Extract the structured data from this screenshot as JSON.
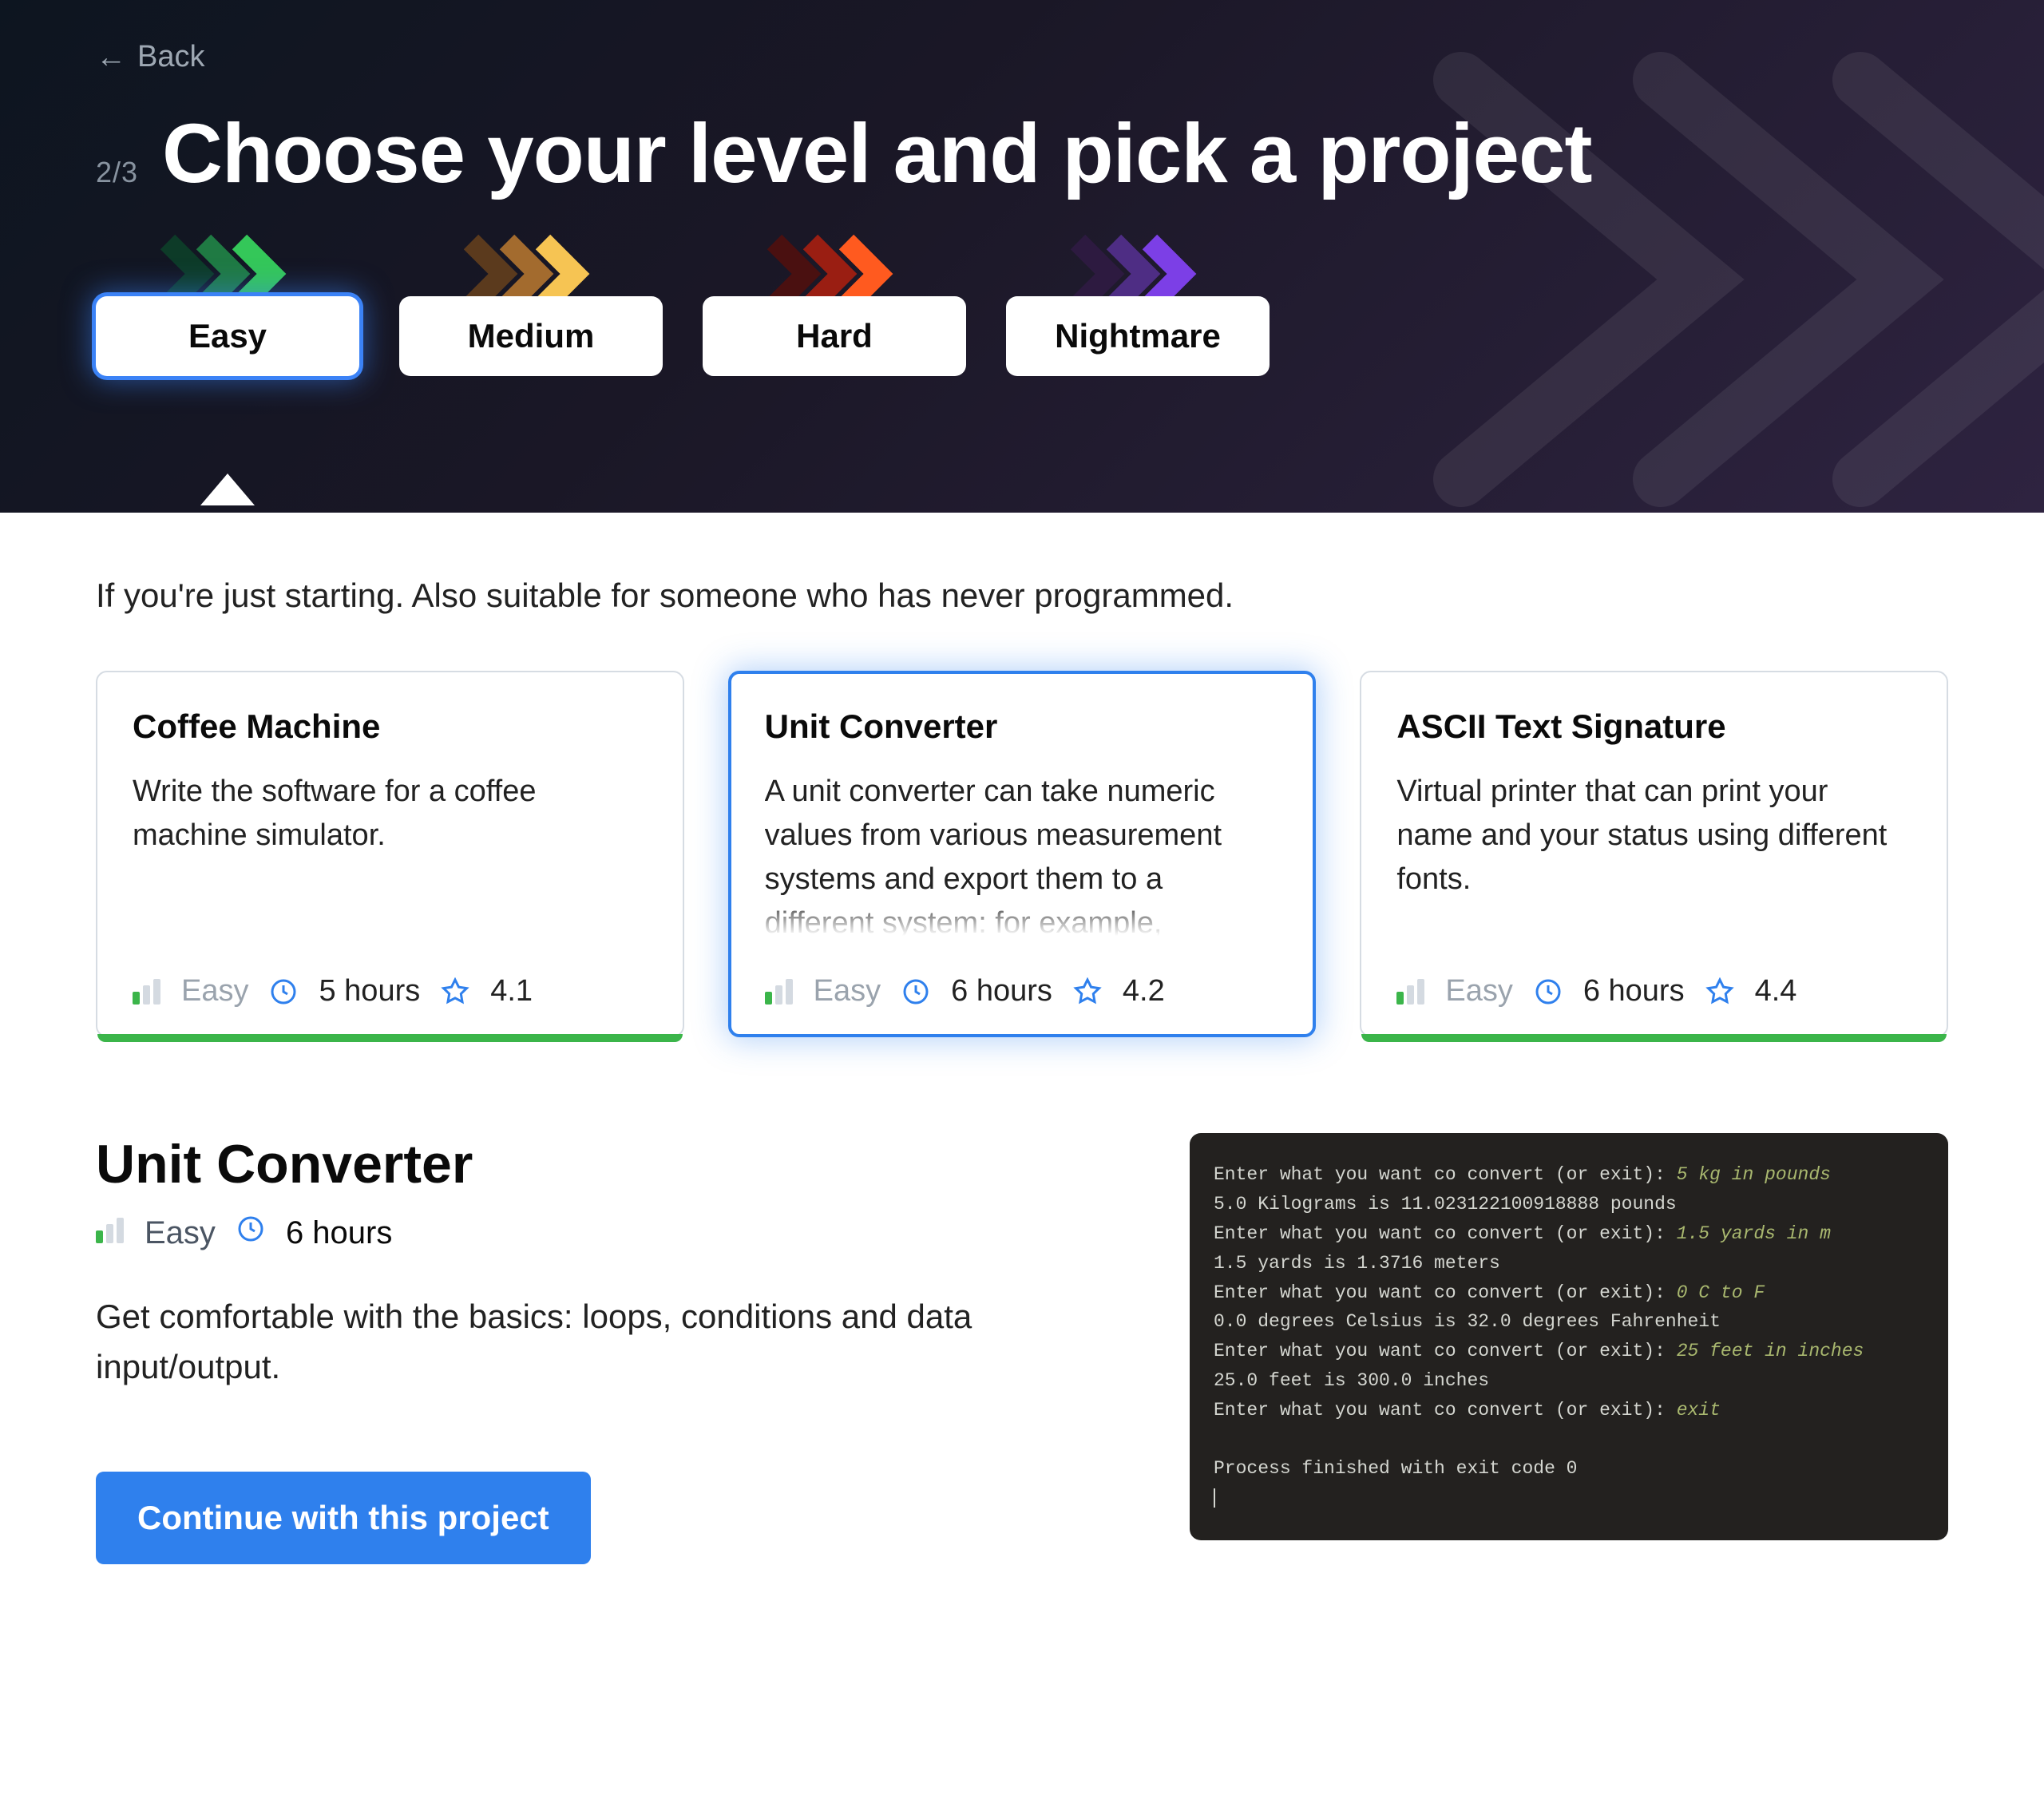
{
  "nav": {
    "back_label": "Back"
  },
  "step": {
    "current": 2,
    "total": 3,
    "display": "2/3"
  },
  "title": "Choose your level and pick a project",
  "levels": {
    "items": [
      {
        "label": "Easy",
        "chevron_colors": [
          "#0d3b28",
          "#1f7a43",
          "#34c759"
        ]
      },
      {
        "label": "Medium",
        "chevron_colors": [
          "#5b3a1d",
          "#a36b2e",
          "#f6c453"
        ]
      },
      {
        "label": "Hard",
        "chevron_colors": [
          "#4a1010",
          "#9a1e12",
          "#ff5a1f"
        ]
      },
      {
        "label": "Nightmare",
        "chevron_colors": [
          "#2d1a40",
          "#4e2d84",
          "#7c3fe6"
        ]
      }
    ],
    "selected_index": 0
  },
  "level_description": "If you're just starting. Also suitable for someone who has never programmed.",
  "projects": {
    "selected_index": 1,
    "items": [
      {
        "title": "Coffee Machine",
        "desc": "Write the software for a coffee machine simulator.",
        "difficulty": "Easy",
        "duration": "5 hours",
        "rating": "4.1",
        "accent": "#3bb54a"
      },
      {
        "title": "Unit Converter",
        "desc": "A unit converter can take numeric values from various measurement systems and export them to a different system: for example,",
        "difficulty": "Easy",
        "duration": "6 hours",
        "rating": "4.2",
        "accent": "#3bb54a"
      },
      {
        "title": "ASCII Text Signature",
        "desc": "Virtual printer that can print your name and your status using different fonts.",
        "difficulty": "Easy",
        "duration": "6 hours",
        "rating": "4.4",
        "accent": "#3bb54a"
      }
    ]
  },
  "detail": {
    "title": "Unit Converter",
    "difficulty": "Easy",
    "duration": "6 hours",
    "desc": "Get comfortable with the basics: loops, conditions and data input/output.",
    "terminal": {
      "lines": [
        {
          "prompt": "Enter what you want co convert (or exit): ",
          "input": "5 kg in pounds"
        },
        {
          "out": "5.0 Kilograms is 11.023122100918888 pounds"
        },
        {
          "prompt": "Enter what you want co convert (or exit): ",
          "input": "1.5 yards in m"
        },
        {
          "out": "1.5 yards is 1.3716 meters"
        },
        {
          "prompt": "Enter what you want co convert (or exit): ",
          "input": "0 C to F"
        },
        {
          "out": "0.0 degrees Celsius is 32.0 degrees Fahrenheit"
        },
        {
          "prompt": "Enter what you want co convert (or exit): ",
          "input": "25 feet in inches"
        },
        {
          "out": "25.0 feet is 300.0 inches"
        },
        {
          "prompt": "Enter what you want co convert (or exit): ",
          "input": "exit"
        },
        {
          "blank": true
        },
        {
          "exit": "Process finished with exit code 0"
        }
      ]
    }
  },
  "cta_label": "Continue with this project"
}
